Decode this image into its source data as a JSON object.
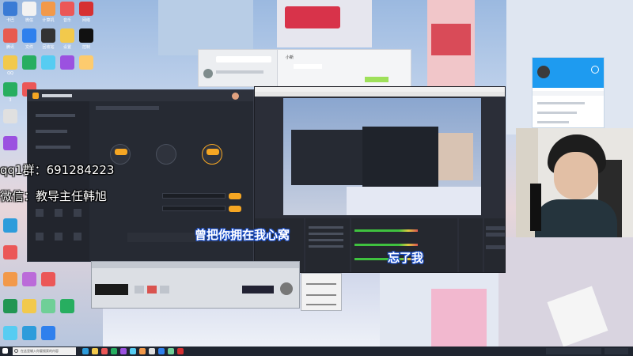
{
  "overlay": {
    "qq_group": "qq1群：691284223",
    "wechat": "微信：教导主任韩旭",
    "lyric_line1": "曾把你拥在我心窝",
    "lyric_line2": "忘了我"
  },
  "chat": {
    "contact_name": "小新"
  },
  "desktop": {
    "labels": [
      "卡巴",
      "腾讯",
      "QQ",
      "3",
      "微信",
      "文件",
      "计算机",
      "回收站",
      "音乐",
      "设置",
      "网络",
      "控制"
    ]
  },
  "taskbar": {
    "search_placeholder": "在这里输入你要搜索的内容"
  },
  "colors": {
    "accent_orange": "#f5a623",
    "obs_dark": "#2b2e38",
    "app_dark": "#262a33",
    "qq_blue": "#1e9bf0",
    "lyric_stroke": "#1a4ec9"
  }
}
